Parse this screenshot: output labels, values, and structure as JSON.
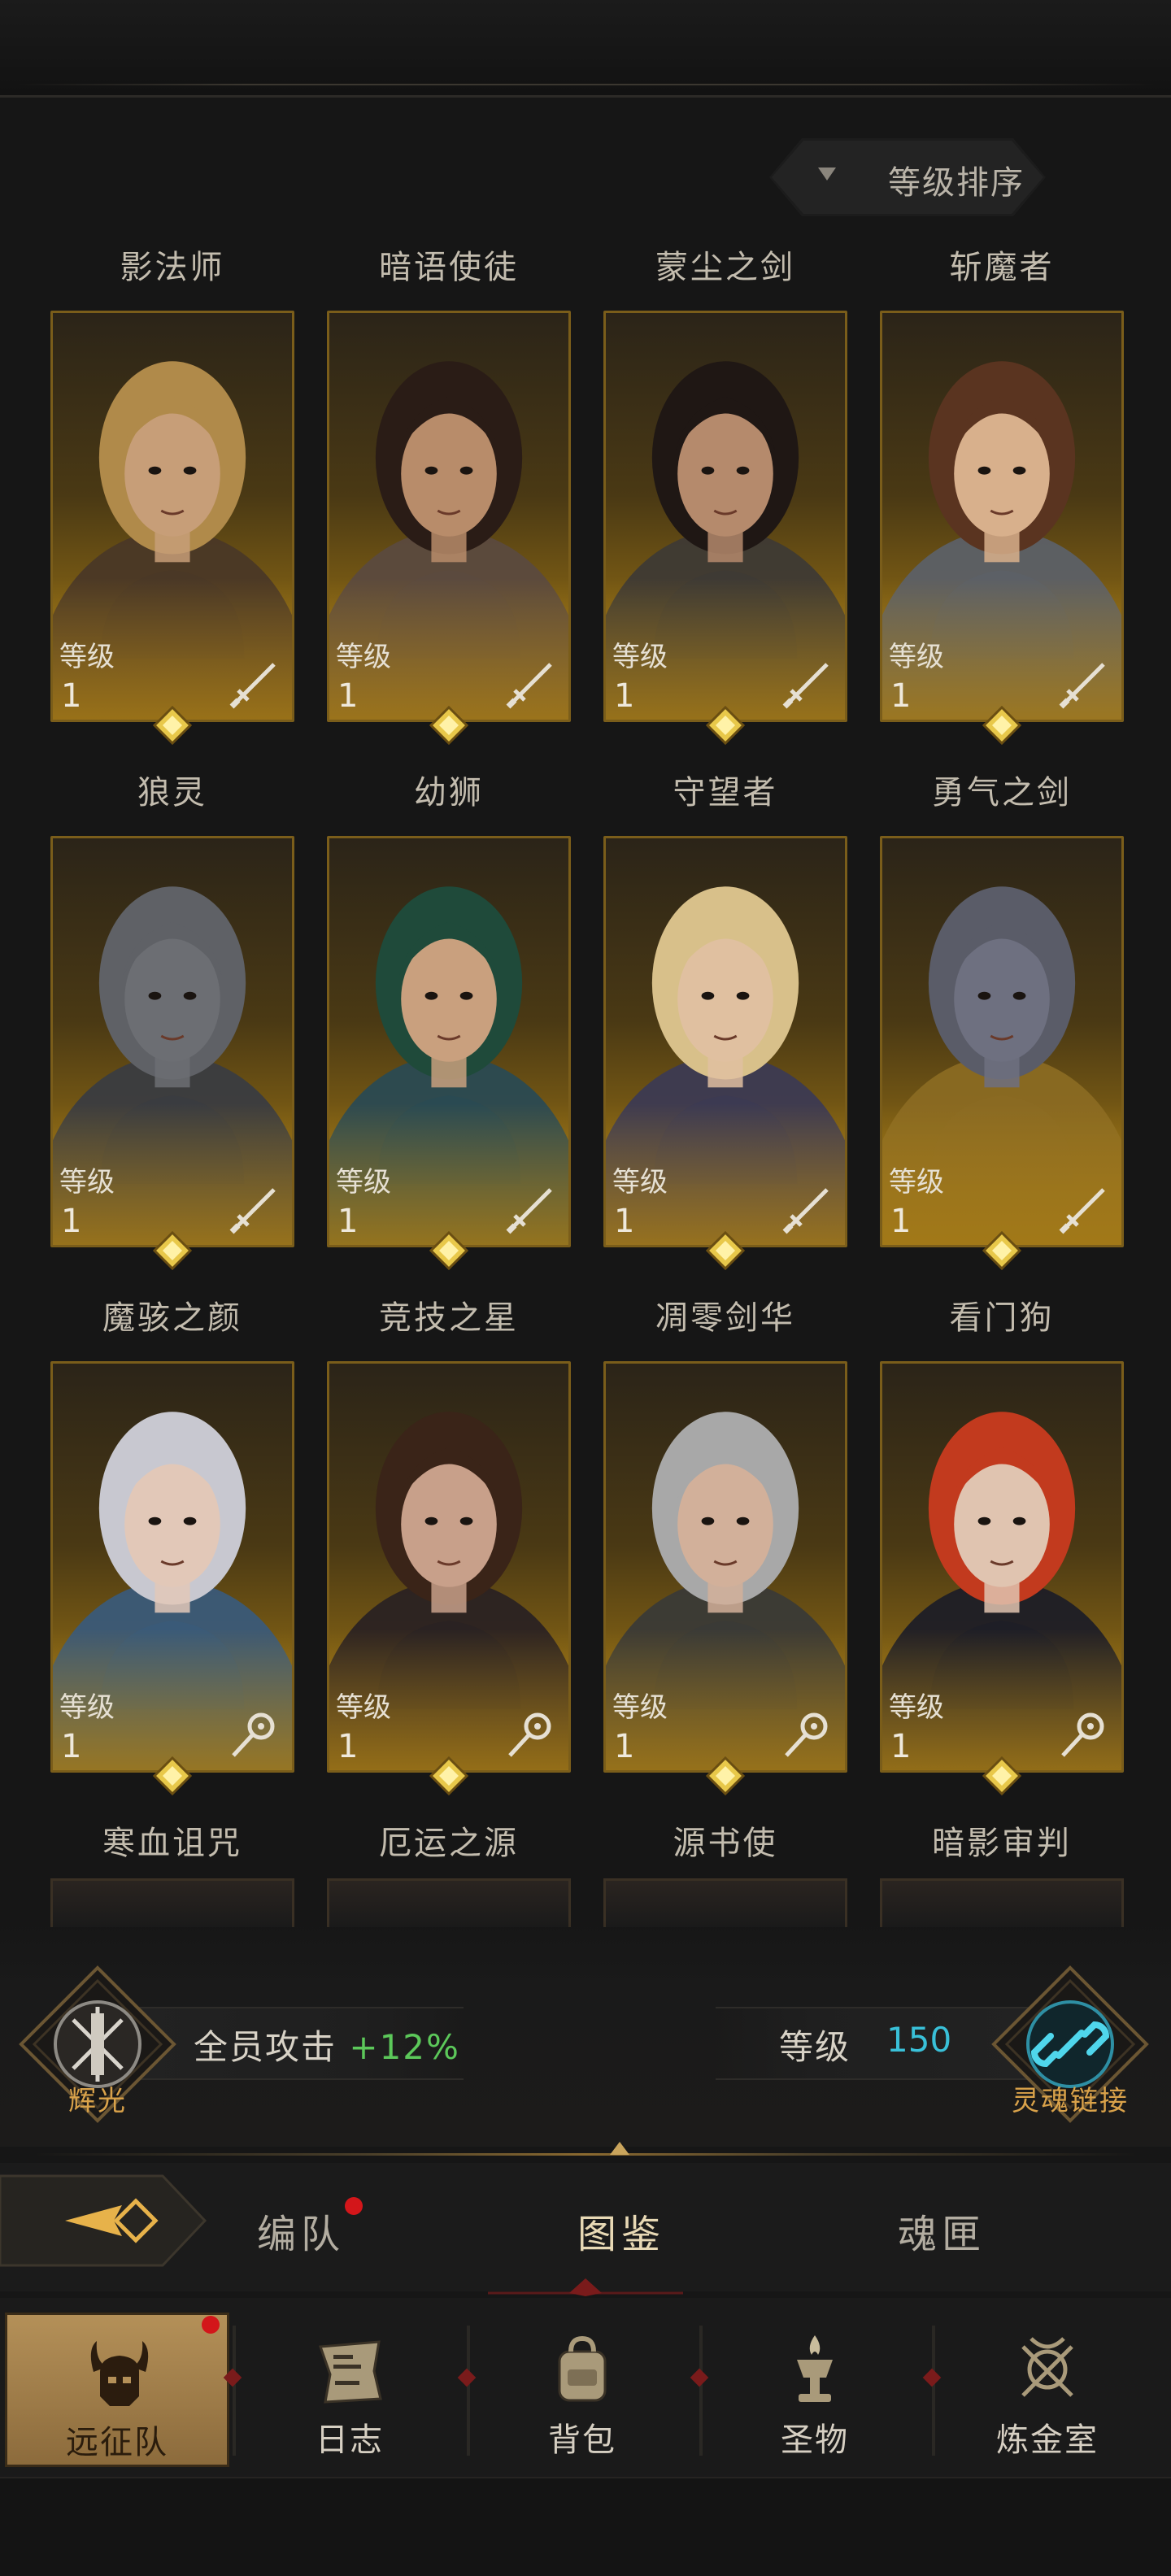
{
  "sort": {
    "label": "等级排序"
  },
  "level_label": "等级",
  "heroes": [
    {
      "name": "影法师",
      "level": "1",
      "type": "sword",
      "hair": "#b08a4a",
      "skin": "#c79e78",
      "cloth": "#4a3826"
    },
    {
      "name": "暗语使徒",
      "level": "1",
      "type": "sword",
      "hair": "#2a1c16",
      "skin": "#b88c6a",
      "cloth": "#5b4a3e"
    },
    {
      "name": "蒙尘之剑",
      "level": "1",
      "type": "sword",
      "hair": "#1f1714",
      "skin": "#b58a6c",
      "cloth": "#3e3a34"
    },
    {
      "name": "斩魔者",
      "level": "1",
      "type": "sword",
      "hair": "#5a3420",
      "skin": "#d8b08c",
      "cloth": "#5c6066"
    },
    {
      "name": "狼灵",
      "level": "1",
      "type": "sword",
      "hair": "#5f6166",
      "skin": "#6c6e73",
      "cloth": "#3a3c40"
    },
    {
      "name": "幼狮",
      "level": "1",
      "type": "sword",
      "hair": "#1f4a3a",
      "skin": "#c9a07e",
      "cloth": "#2a4a52"
    },
    {
      "name": "守望者",
      "level": "1",
      "type": "sword",
      "hair": "#d8c08a",
      "skin": "#e0c0a0",
      "cloth": "#3c3a52"
    },
    {
      "name": "勇气之剑",
      "level": "1",
      "type": "sword",
      "hair": "#5a5c68",
      "skin": "#6e7080",
      "cloth": "#8a6a22"
    },
    {
      "name": "魔骇之颜",
      "level": "1",
      "type": "staff",
      "hair": "#c8c8d0",
      "skin": "#e2c8b8",
      "cloth": "#3a5a78"
    },
    {
      "name": "竞技之星",
      "level": "1",
      "type": "staff",
      "hair": "#3a2418",
      "skin": "#c8a08a",
      "cloth": "#2a2222"
    },
    {
      "name": "凋零剑华",
      "level": "1",
      "type": "staff",
      "hair": "#a8a8a8",
      "skin": "#d2b09a",
      "cloth": "#3a3a36"
    },
    {
      "name": "看门狗",
      "level": "1",
      "type": "staff",
      "hair": "#c23a1e",
      "skin": "#e0c4b0",
      "cloth": "#1e1e26"
    }
  ],
  "bottom_names": [
    "寒血诅咒",
    "厄运之源",
    "源书使",
    "暗影审判"
  ],
  "bonus": {
    "left_emblem_label": "辉光",
    "stat_label": "全员攻击",
    "stat_value": "+12%",
    "level_label": "等级",
    "level_value": "150",
    "right_emblem_label": "灵魂链接"
  },
  "subtabs": {
    "formation": "编队",
    "codex": "图鉴",
    "soul_box": "魂匣"
  },
  "nav": {
    "expedition": "远征队",
    "journal": "日志",
    "backpack": "背包",
    "relics": "圣物",
    "alchemy": "炼金室"
  },
  "colors": {
    "gold": "#b3861a",
    "green": "#5cc85a",
    "cyan": "#39c0d8",
    "emblem_label": "#d9a24a",
    "alert_red": "#d3161a"
  }
}
